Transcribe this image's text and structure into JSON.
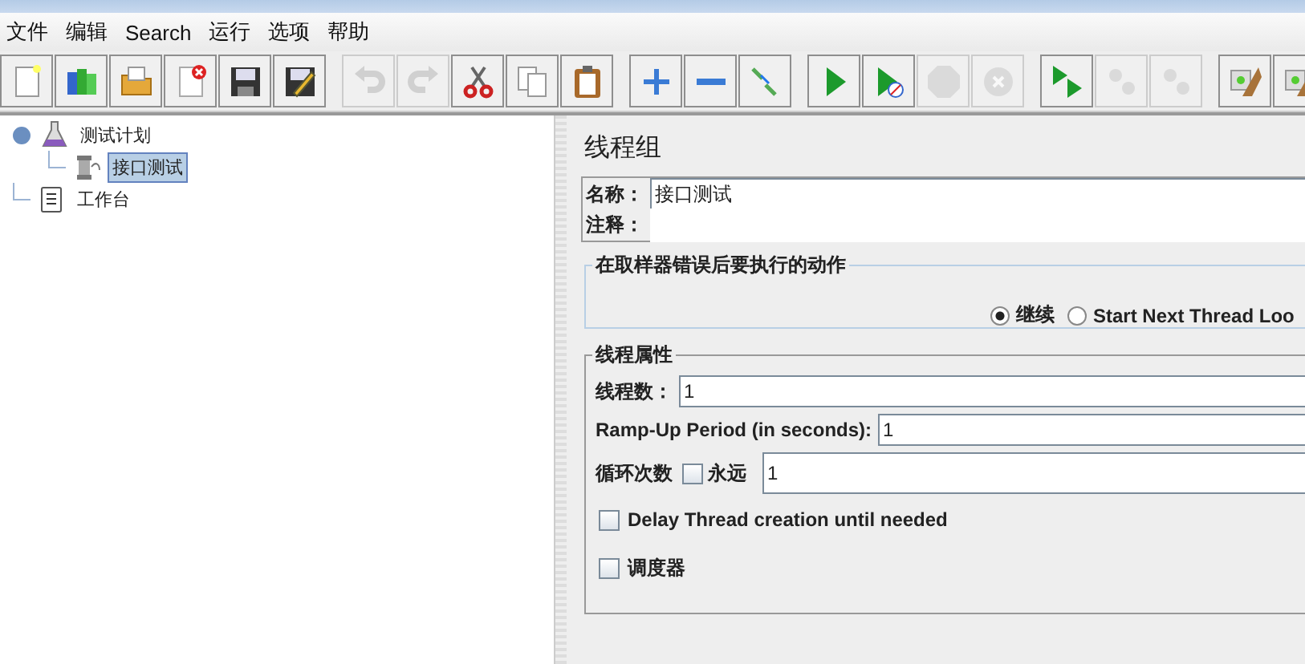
{
  "menu": [
    {
      "label": "文件"
    },
    {
      "label": "编辑"
    },
    {
      "label": "Search"
    },
    {
      "label": "运行"
    },
    {
      "label": "选项"
    },
    {
      "label": "帮助"
    }
  ],
  "toolbar": [
    [
      {
        "kind": "new",
        "disabled": false
      },
      {
        "kind": "templates",
        "disabled": false
      },
      {
        "kind": "open",
        "disabled": false
      },
      {
        "kind": "close",
        "disabled": false
      },
      {
        "kind": "save",
        "disabled": false
      },
      {
        "kind": "save-as",
        "disabled": false
      }
    ],
    [
      {
        "kind": "undo",
        "disabled": true
      },
      {
        "kind": "redo",
        "disabled": true
      },
      {
        "kind": "cut",
        "disabled": false
      },
      {
        "kind": "copy",
        "disabled": false
      },
      {
        "kind": "paste",
        "disabled": false
      }
    ],
    [
      {
        "kind": "expand",
        "disabled": false
      },
      {
        "kind": "collapse",
        "disabled": false
      },
      {
        "kind": "toggle",
        "disabled": false
      }
    ],
    [
      {
        "kind": "start",
        "disabled": false
      },
      {
        "kind": "start-no-timers",
        "disabled": false
      },
      {
        "kind": "stop",
        "disabled": true
      },
      {
        "kind": "shutdown",
        "disabled": true
      }
    ],
    [
      {
        "kind": "remote-start",
        "disabled": false
      },
      {
        "kind": "remote-stop",
        "disabled": true
      },
      {
        "kind": "remote-shutdown",
        "disabled": true
      }
    ],
    [
      {
        "kind": "clear",
        "disabled": false
      },
      {
        "kind": "clear-all",
        "disabled": false
      }
    ]
  ],
  "tree": [
    {
      "label": "测试计划",
      "kind": "test-plan",
      "expanded": true,
      "selected": false,
      "children": [
        {
          "label": "接口测试",
          "kind": "thread-group",
          "selected": true
        }
      ]
    },
    {
      "label": "工作台",
      "kind": "workbench",
      "selected": false
    }
  ],
  "panel": {
    "title": "线程组",
    "name_label": "名称：",
    "name_value": "接口测试",
    "comments_label": "注释：",
    "error_action": {
      "legend": "在取样器错误后要执行的动作",
      "options": [
        {
          "label": "继续",
          "selected": true
        },
        {
          "label": "Start Next Thread Loo",
          "selected": false
        }
      ]
    },
    "thread_properties": {
      "legend": "线程属性",
      "threads": {
        "label": "线程数：",
        "value": "1"
      },
      "ramp_up": {
        "label": "Ramp-Up Period (in seconds):",
        "value": "1"
      },
      "loop": {
        "label": "循环次数",
        "forever_label": "永远",
        "forever_checked": false,
        "value": "1"
      },
      "delay": {
        "label": "Delay Thread creation until needed",
        "checked": false
      },
      "scheduler": {
        "label": "调度器",
        "checked": false
      }
    }
  }
}
